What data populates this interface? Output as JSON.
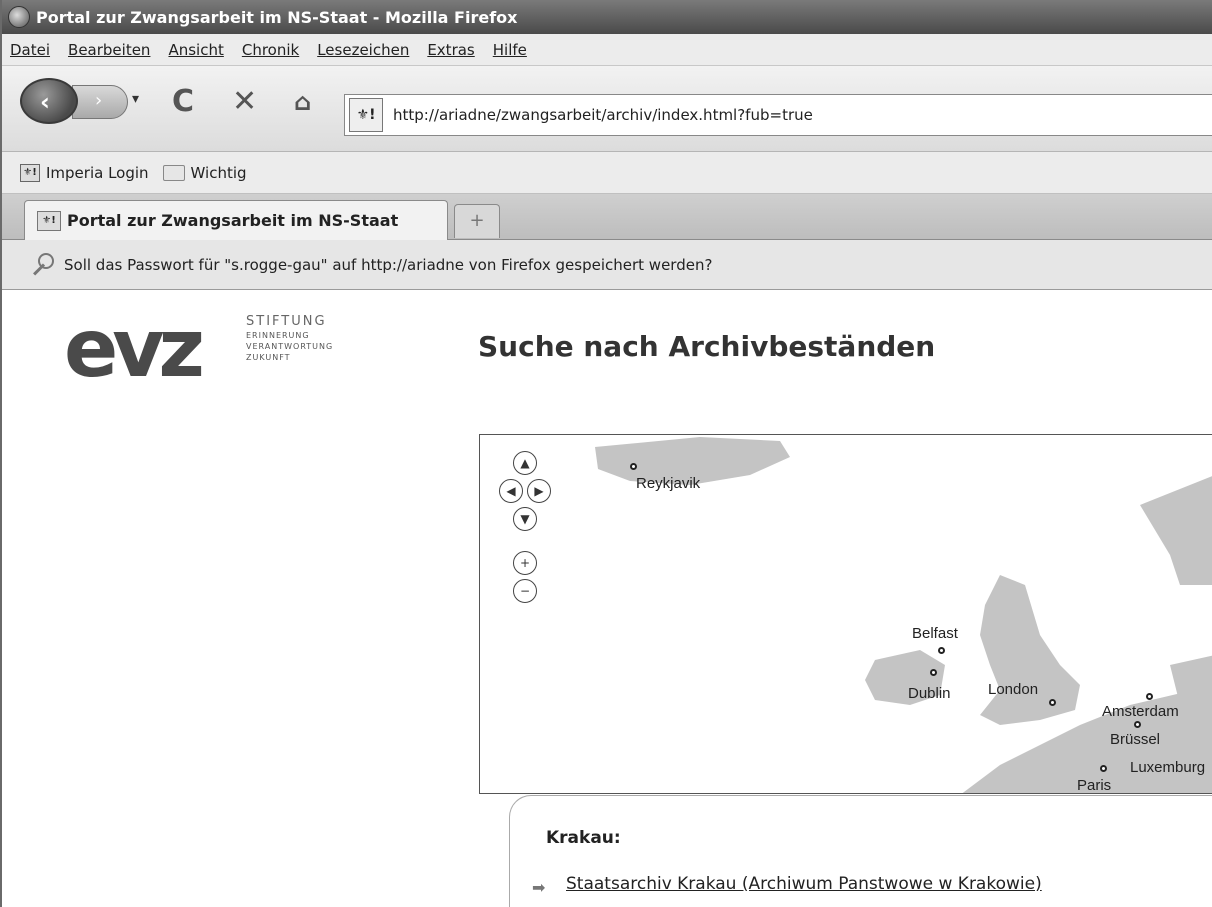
{
  "window": {
    "title": "Portal zur Zwangsarbeit im NS-Staat - Mozilla Firefox"
  },
  "menubar": {
    "items": [
      "Datei",
      "Bearbeiten",
      "Ansicht",
      "Chronik",
      "Lesezeichen",
      "Extras",
      "Hilfe"
    ]
  },
  "navbar": {
    "url": "http://ariadne/zwangsarbeit/archiv/index.html?fub=true"
  },
  "bookmarks": {
    "items": [
      {
        "label": "Imperia Login",
        "icon": "site-icon"
      },
      {
        "label": "Wichtig",
        "icon": "folder-icon"
      }
    ]
  },
  "tabs": {
    "active_label": "Portal zur Zwangsarbeit im NS-Staat",
    "new_tab": "+"
  },
  "notification": {
    "text": "Soll das Passwort für \"s.rogge-gau\" auf http://ariadne von Firefox gespeichert werden?"
  },
  "logo": {
    "mark": "evz",
    "line1": "STIFTUNG",
    "line2": "ERINNERUNG",
    "line3": "VERANTWORTUNG",
    "line4": "ZUKUNFT"
  },
  "page": {
    "title": "Suche nach Archivbeständen"
  },
  "map": {
    "controls": {
      "up": "▲",
      "left": "◀",
      "right": "▶",
      "down": "▼",
      "zoom_in": "+",
      "zoom_out": "−"
    },
    "cities": [
      "Reykjavik",
      "Belfast",
      "Dublin",
      "London",
      "Amsterdam",
      "Brüssel",
      "Luxemburg",
      "Paris"
    ]
  },
  "popup": {
    "title": "Krakau:",
    "link": "Staatsarchiv Krakau (Archiwum Panstwowe w Krakowie)"
  }
}
